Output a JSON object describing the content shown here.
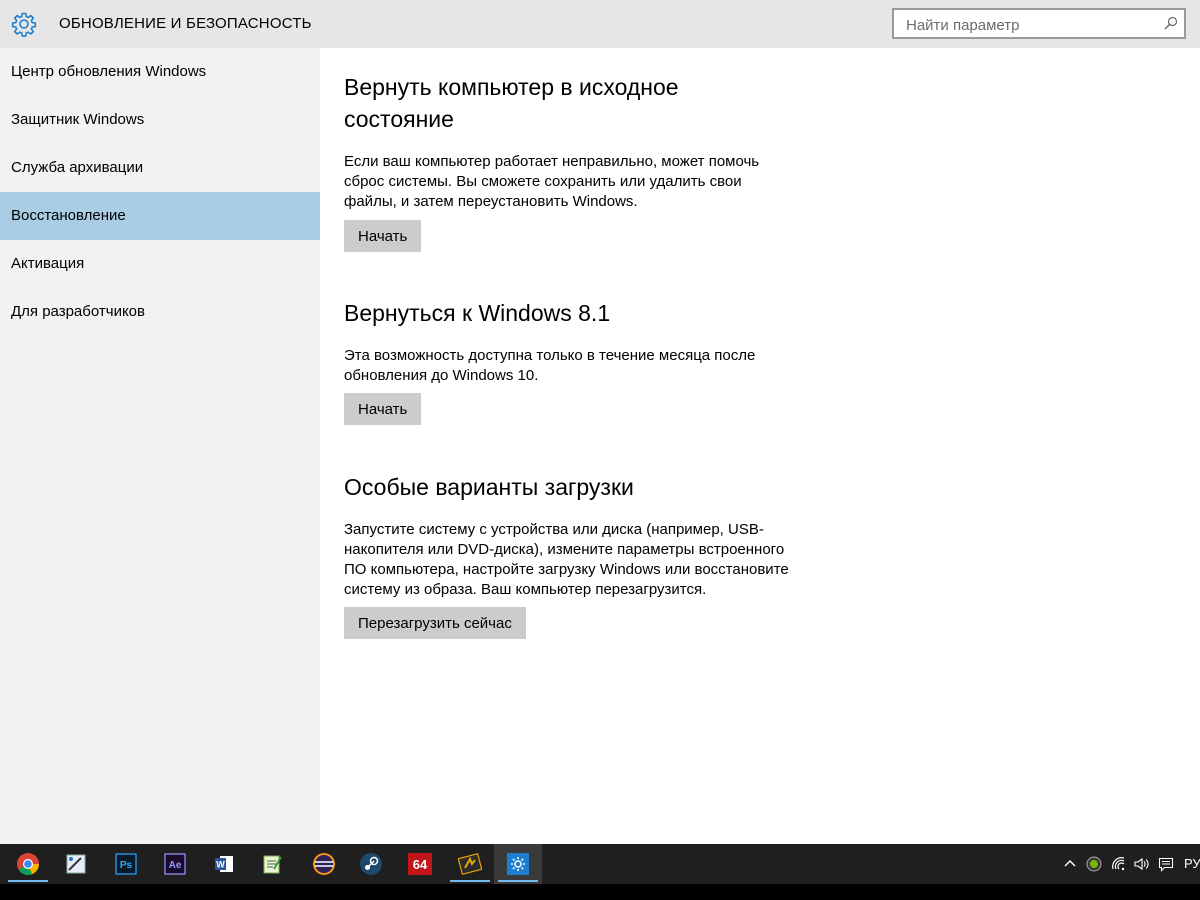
{
  "header": {
    "title": "ОБНОВЛЕНИЕ И БЕЗОПАСНОСТЬ",
    "icon": "gear-icon",
    "search_placeholder": "Найти параметр"
  },
  "sidebar": {
    "items": [
      {
        "label": "Центр обновления Windows",
        "active": false
      },
      {
        "label": "Защитник Windows",
        "active": false
      },
      {
        "label": "Служба архивации",
        "active": false
      },
      {
        "label": "Восстановление",
        "active": true
      },
      {
        "label": "Активация",
        "active": false
      },
      {
        "label": "Для разработчиков",
        "active": false
      }
    ]
  },
  "sections": [
    {
      "title": "Вернуть компьютер в исходное состояние",
      "description": "Если ваш компьютер работает неправильно, может помочь сброс системы. Вы сможете сохранить или удалить свои файлы, и затем переустановить Windows.",
      "button": "Начать"
    },
    {
      "title": "Вернуться к Windows 8.1",
      "description": "Эта возможность доступна только в течение месяца после обновления до Windows 10.",
      "button": "Начать"
    },
    {
      "title": "Особые варианты загрузки",
      "description": "Запустите систему с устройства или диска (например, USB-накопителя или DVD-диска), измените параметры встроенного ПО компьютера, настройте загрузку Windows или восстановите систему из образа. Ваш компьютер перезагрузится.",
      "button": "Перезагрузить сейчас"
    }
  ],
  "taskbar": {
    "apps": [
      {
        "icon": "chrome-icon",
        "running": true
      },
      {
        "icon": "paint-icon",
        "running": false
      },
      {
        "icon": "photoshop-icon",
        "label": "Ps",
        "running": false
      },
      {
        "icon": "after-effects-icon",
        "label": "Ae",
        "running": false
      },
      {
        "icon": "word-icon",
        "running": false
      },
      {
        "icon": "notepad-plus-plus-icon",
        "running": false
      },
      {
        "icon": "eclipse-icon",
        "running": false
      },
      {
        "icon": "steam-icon",
        "running": false
      },
      {
        "icon": "aida64-icon",
        "label": "64",
        "running": false
      },
      {
        "icon": "winamp-icon",
        "running": true
      },
      {
        "icon": "settings-icon",
        "running": true,
        "active": true
      }
    ],
    "tray": [
      "chevron-up-icon",
      "nvidia-icon",
      "network-icon",
      "volume-icon",
      "action-center-icon"
    ],
    "language": "РУ"
  },
  "colors": {
    "header_bg": "#e6e6e6",
    "sidebar_bg": "#f2f2f2",
    "active_nav": "#a8cde4",
    "button_bg": "#cccccc",
    "accent": "#1e7fd1",
    "taskbar_bg": "#1f1f1f"
  }
}
